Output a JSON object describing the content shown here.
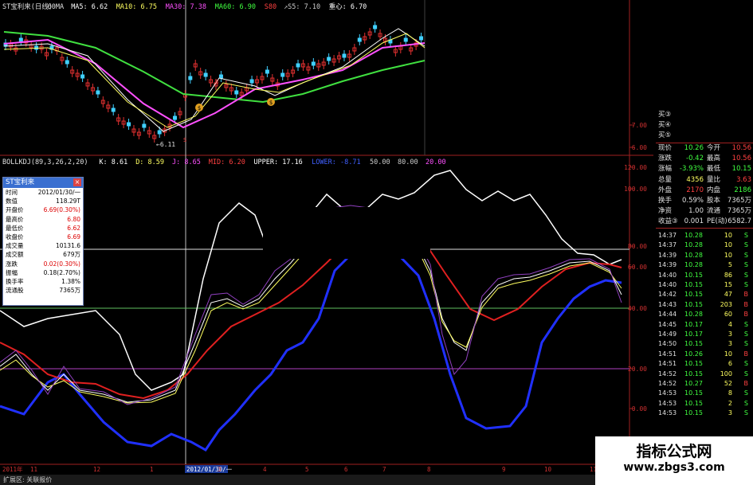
{
  "top_panel": {
    "header": [
      {
        "text": "ST宝利来(日线)",
        "color": "#e0e0e0"
      },
      {
        "text": "60MA",
        "color": "#e0e0e0"
      },
      {
        "text": "MA5: 6.62",
        "color": "#ffffff"
      },
      {
        "text": "MA10: 6.75",
        "color": "#ffff60"
      },
      {
        "text": "MA30: 7.38",
        "color": "#ff50ff"
      },
      {
        "text": "MA60: 6.90",
        "color": "#40ff40"
      },
      {
        "text": "S80",
        "color": "#ff4040"
      },
      {
        "text": "↗S5: 7.10",
        "color": "#cccccc"
      },
      {
        "text": "重心: 6.70",
        "color": "#ffffff"
      }
    ],
    "low_label": "←6.11",
    "price_axis": [
      "7.00",
      "6.00"
    ],
    "marker_glyph": "$",
    "sell_glyph": "S",
    "buy_glyph": "B"
  },
  "bottom_panel": {
    "header": [
      {
        "text": "BOLLKDJ(89,3,26,2,20)",
        "color": "#e0e0e0"
      },
      {
        "text": "K: 8.61",
        "color": "#ffffff"
      },
      {
        "text": "D: 8.59",
        "color": "#ffff60"
      },
      {
        "text": "J: 8.65",
        "color": "#ff50ff"
      },
      {
        "text": "MID: 6.20",
        "color": "#ff4040"
      },
      {
        "text": "UPPER: 17.16",
        "color": "#ffffff"
      },
      {
        "text": "LOWER: -8.71",
        "color": "#4060ff"
      },
      {
        "text": "50.00",
        "color": "#cccccc"
      },
      {
        "text": "80.00",
        "color": "#cccccc"
      },
      {
        "text": "20.00",
        "color": "#ff50ff"
      }
    ],
    "axis": [
      "120.00",
      "100.00",
      "80.00",
      "60.00",
      "40.00",
      "20.00",
      "0.00",
      "-20.00"
    ]
  },
  "info_box": {
    "title": "ST宝利来",
    "close": "×",
    "rows": [
      {
        "k": "时间",
        "v": "2012/01/30/一",
        "c": "#000"
      },
      {
        "k": "数值",
        "v": "118.29T",
        "c": "#000"
      },
      {
        "k": "开盘价",
        "v": "6.69(0.30%)",
        "c": "#d00"
      },
      {
        "k": "最高价",
        "v": "6.80",
        "c": "#d00"
      },
      {
        "k": "最低价",
        "v": "6.62",
        "c": "#d00"
      },
      {
        "k": "收盘价",
        "v": "6.69",
        "c": "#d00"
      },
      {
        "k": "成交量",
        "v": "10131.6",
        "c": "#000"
      },
      {
        "k": "成交额",
        "v": "679万",
        "c": "#000"
      },
      {
        "k": "涨跌",
        "v": "0.02(0.30%)",
        "c": "#d00"
      },
      {
        "k": "振幅",
        "v": "0.18(2.70%)",
        "c": "#000"
      },
      {
        "k": "换手率",
        "v": "1.38%",
        "c": "#000"
      },
      {
        "k": "流通股",
        "v": "7365万",
        "c": "#000"
      }
    ]
  },
  "quote_panel": {
    "buy_levels": [
      "买③",
      "买④",
      "买⑤"
    ],
    "stats": [
      {
        "l1": "现价",
        "v1": "10.26",
        "c1": "#40ff40",
        "l2": "今开",
        "v2": "10.56",
        "c2": "#ff4040"
      },
      {
        "l1": "涨跌",
        "v1": "-0.42",
        "c1": "#40ff40",
        "l2": "最高",
        "v2": "10.56",
        "c2": "#ff4040"
      },
      {
        "l1": "涨幅",
        "v1": "-3.93%",
        "c1": "#40ff40",
        "l2": "最低",
        "v2": "10.15",
        "c2": "#40ff40"
      },
      {
        "l1": "总量",
        "v1": "4356",
        "c1": "#ffff60",
        "l2": "量比",
        "v2": "3.63",
        "c2": "#ff4040"
      },
      {
        "l1": "外盘",
        "v1": "2170",
        "c1": "#ff4040",
        "l2": "内盘",
        "v2": "2186",
        "c2": "#40ff40"
      },
      {
        "l1": "换手",
        "v1": "0.59%",
        "c1": "#e0e0e0",
        "l2": "股本",
        "v2": "7365万",
        "c2": "#e0e0e0"
      },
      {
        "l1": "净资",
        "v1": "1.00",
        "c1": "#e0e0e0",
        "l2": "流通",
        "v2": "7365万",
        "c2": "#e0e0e0"
      },
      {
        "l1": "收益③",
        "v1": "0.001",
        "c1": "#e0e0e0",
        "l2": "PE(动)",
        "v2": "6582.7",
        "c2": "#e0e0e0"
      }
    ],
    "ticks": [
      {
        "t": "14:37",
        "p": "10.28",
        "v": "10",
        "s": "S"
      },
      {
        "t": "14:37",
        "p": "10.28",
        "v": "10",
        "s": "S"
      },
      {
        "t": "14:39",
        "p": "10.28",
        "v": "10",
        "s": "S"
      },
      {
        "t": "14:39",
        "p": "10.28",
        "v": "5",
        "s": "S"
      },
      {
        "t": "14:40",
        "p": "10.15",
        "v": "86",
        "s": "S"
      },
      {
        "t": "14:40",
        "p": "10.15",
        "v": "15",
        "s": "S"
      },
      {
        "t": "14:42",
        "p": "10.15",
        "v": "47",
        "s": "B"
      },
      {
        "t": "14:43",
        "p": "10.15",
        "v": "203",
        "s": "B"
      },
      {
        "t": "14:44",
        "p": "10.28",
        "v": "60",
        "s": "B"
      },
      {
        "t": "14:45",
        "p": "10.17",
        "v": "4",
        "s": "S"
      },
      {
        "t": "14:49",
        "p": "10.17",
        "v": "3",
        "s": "S"
      },
      {
        "t": "14:50",
        "p": "10.15",
        "v": "3",
        "s": "S"
      },
      {
        "t": "14:51",
        "p": "10.26",
        "v": "10",
        "s": "B"
      },
      {
        "t": "14:51",
        "p": "10.15",
        "v": "6",
        "s": "S"
      },
      {
        "t": "14:52",
        "p": "10.15",
        "v": "100",
        "s": "S"
      },
      {
        "t": "14:52",
        "p": "10.27",
        "v": "52",
        "s": "B"
      },
      {
        "t": "14:53",
        "p": "10.15",
        "v": "8",
        "s": "S"
      },
      {
        "t": "14:53",
        "p": "10.15",
        "v": "2",
        "s": "S"
      },
      {
        "t": "14:53",
        "p": "10.15",
        "v": "3",
        "s": "S"
      }
    ]
  },
  "x_axis": [
    "2011年",
    "11",
    "12",
    "1",
    "2012/01/30/一",
    "3",
    "4",
    "5",
    "6",
    "7",
    "8",
    "9",
    "10",
    "11"
  ],
  "status_bar": "扩展区: 关联报价",
  "watermark": {
    "title": "指标公式网",
    "url": "www.zbgs3.com"
  },
  "colors": {
    "white": "#ffffff",
    "yellow": "#ffff60",
    "magenta": "#ff50ff",
    "red": "#e02020",
    "blue": "#2030ff",
    "green": "#40e040",
    "purple": "#9040c0"
  }
}
